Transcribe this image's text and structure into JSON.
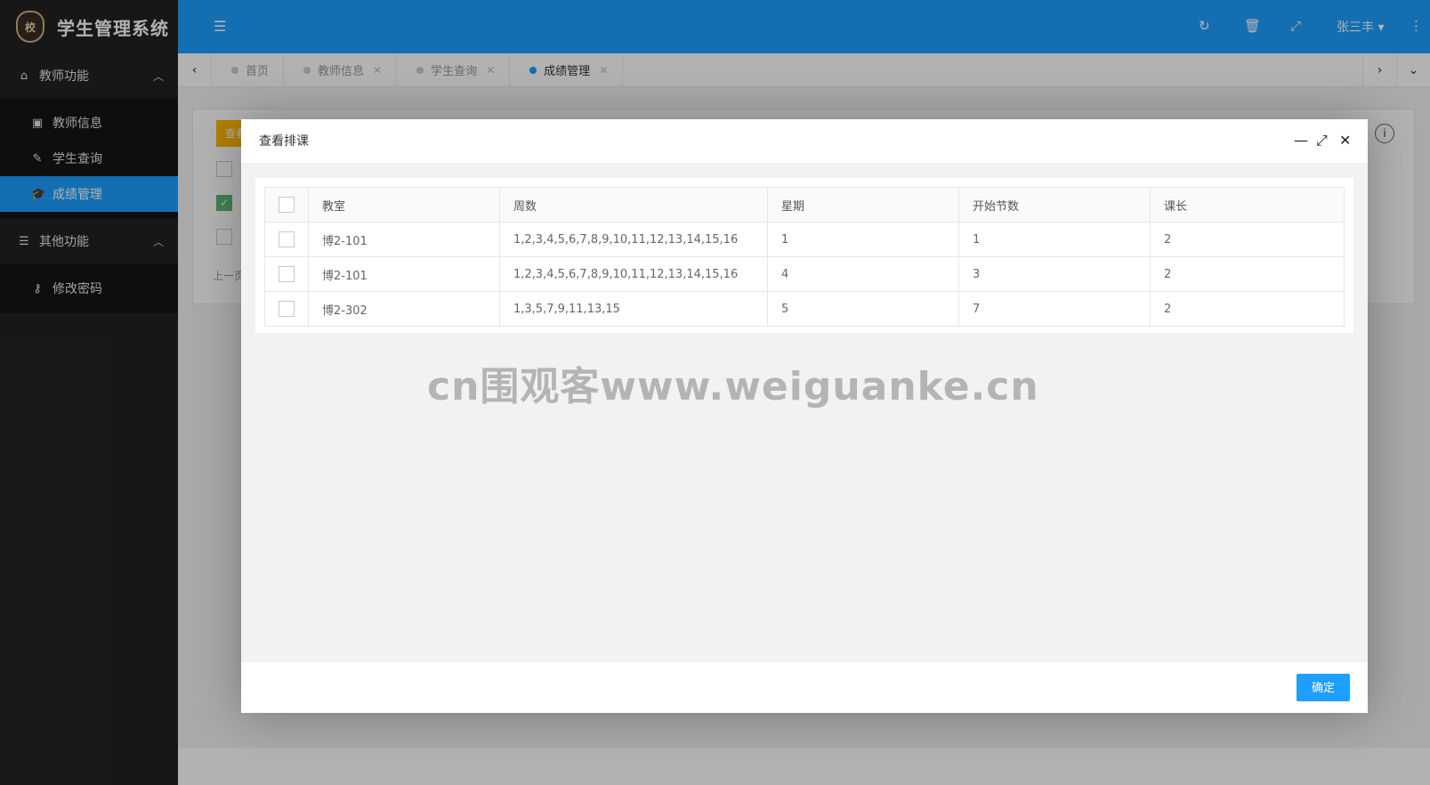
{
  "app": {
    "title": "学生管理系统",
    "logo_text": "校"
  },
  "sidebar": {
    "groups": [
      {
        "label": "教师功能",
        "icon": "home-icon",
        "items": [
          {
            "label": "教师信息",
            "icon": "briefcase-icon"
          },
          {
            "label": "学生查询",
            "icon": "pencil-icon"
          },
          {
            "label": "成绩管理",
            "icon": "graduation-cap-icon",
            "active": true
          }
        ]
      },
      {
        "label": "其他功能",
        "icon": "list-icon",
        "items": [
          {
            "label": "修改密码",
            "icon": "key-icon"
          }
        ]
      }
    ]
  },
  "header": {
    "user": "张三丰"
  },
  "tabs": [
    {
      "label": "首页"
    },
    {
      "label": "教师信息"
    },
    {
      "label": "学生查询"
    },
    {
      "label": "成绩管理",
      "active": true
    }
  ],
  "background_card": {
    "button_label": "查看",
    "pager_text": "上一页"
  },
  "modal": {
    "title": "查看排课",
    "columns": [
      "教室",
      "周数",
      "星期",
      "开始节数",
      "课长"
    ],
    "rows": [
      [
        "博2-101",
        "1,2,3,4,5,6,7,8,9,10,11,12,13,14,15,16",
        "1",
        "1",
        "2"
      ],
      [
        "博2-101",
        "1,2,3,4,5,6,7,8,9,10,11,12,13,14,15,16",
        "4",
        "3",
        "2"
      ],
      [
        "博2-302",
        "1,3,5,7,9,11,13,15",
        "5",
        "7",
        "2"
      ]
    ],
    "ok_label": "确定"
  },
  "watermark": "cn围观客www.weiguanke.cn",
  "colors": {
    "primary": "#1E9FFF",
    "sidebar": "#222222",
    "warn": "#FFB800",
    "check": "#5FB878"
  }
}
